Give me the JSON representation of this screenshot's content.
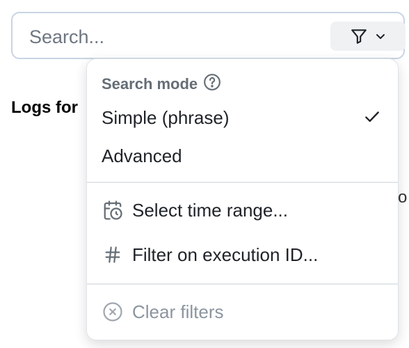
{
  "search": {
    "placeholder": "Search..."
  },
  "background": {
    "logs_heading": "Logs for",
    "edge_fragment": "o"
  },
  "menu": {
    "search_mode_header": "Search mode",
    "modes": [
      {
        "label": "Simple (phrase)",
        "selected": true
      },
      {
        "label": "Advanced",
        "selected": false
      }
    ],
    "actions": [
      {
        "label": "Select time range...",
        "icon": "calendar-clock-icon"
      },
      {
        "label": "Filter on execution ID...",
        "icon": "hash-icon"
      }
    ],
    "clear": {
      "label": "Clear filters",
      "icon": "x-circle-icon",
      "disabled": true
    }
  },
  "colors": {
    "border": "#c9d4e3",
    "button_bg": "#eff1f3",
    "muted": "#8c959f"
  }
}
